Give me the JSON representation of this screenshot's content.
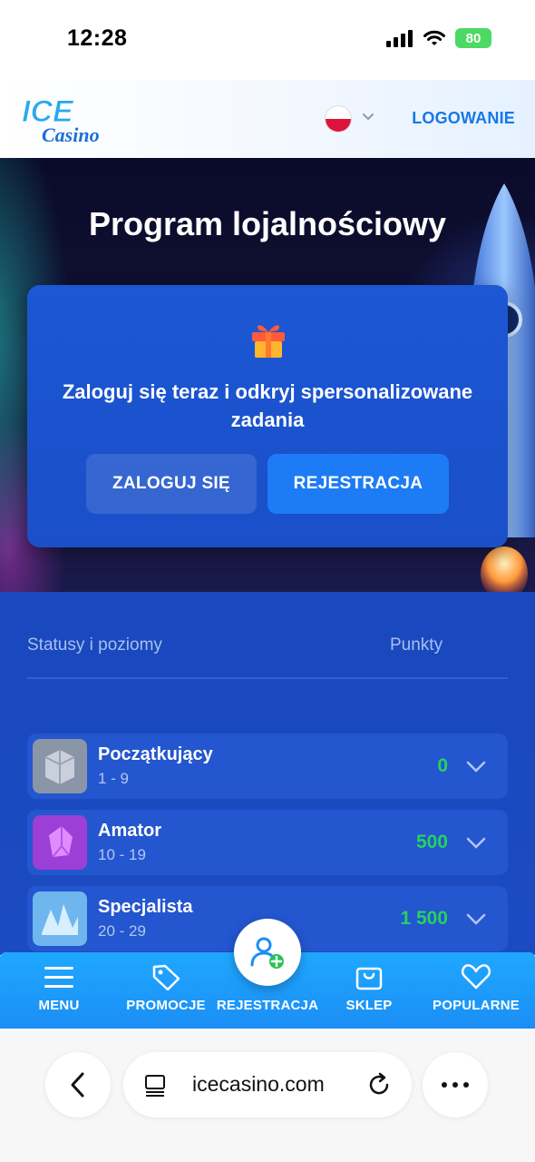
{
  "status_bar": {
    "time": "12:28",
    "battery": "80"
  },
  "header": {
    "logo_top": "ICE",
    "logo_bottom": "Casino",
    "login": "LOGOWANIE"
  },
  "hero": {
    "title": "Program lojalnościowy",
    "promo_text": "Zaloguj się teraz i odkryj spersonalizowane zadania",
    "login_button": "ZALOGUJ SIĘ",
    "register_button": "REJESTRACJA"
  },
  "loyalty": {
    "col_left": "Statusy i poziomy",
    "col_right": "Punkty",
    "levels": [
      {
        "name": "Początkujący",
        "range": "1 - 9",
        "points": "0"
      },
      {
        "name": "Amator",
        "range": "10 - 19",
        "points": "500"
      },
      {
        "name": "Specjalista",
        "range": "20 - 29",
        "points": "1 500"
      }
    ]
  },
  "bottom_nav": {
    "items": [
      {
        "label": "MENU",
        "icon": "menu-icon"
      },
      {
        "label": "PROMOCJE",
        "icon": "tag-icon"
      },
      {
        "label": "REJESTRACJA",
        "icon": "add-user-icon"
      },
      {
        "label": "SKLEP",
        "icon": "shopping-bag-icon"
      },
      {
        "label": "POPULARNE",
        "icon": "heart-icon"
      }
    ]
  },
  "browser": {
    "url": "icecasino.com"
  },
  "colors": {
    "accent": "#1d7bf5",
    "points_green": "#27d15e",
    "nav_blue": "#1b8ef5"
  }
}
